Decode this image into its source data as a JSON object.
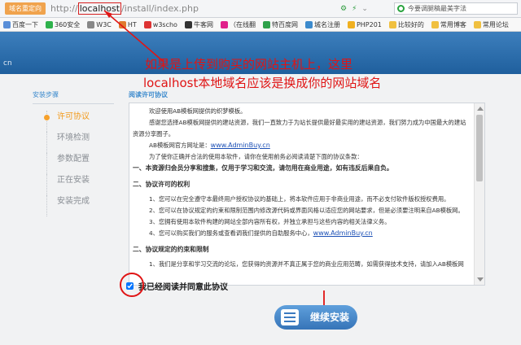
{
  "browser": {
    "redirect_label": "域名重定向",
    "url_prefix": "http://",
    "url_host": "localhost",
    "url_path": "/install/index.php",
    "search_text": "今要调腿稿最美字法"
  },
  "bookmarks": [
    "百度一下",
    "360安全",
    "W3C",
    "HT",
    "w3scho",
    "牛客网",
    "（在线翻",
    "特百度网",
    "城名注册",
    "PHP201",
    "比较好的",
    "常用博客",
    "常用论坛"
  ],
  "banner": {
    "logo_text": "",
    "logo_subtext": "cn"
  },
  "annotation": {
    "line1": "如果是上传到购买的网站主机上，这里",
    "line2": "localhost本地域名应该是换成你的网站域名"
  },
  "steps": {
    "title": "安装步骤",
    "items": [
      "许可协议",
      "环境检测",
      "参数配置",
      "正在安装",
      "安装完成"
    ],
    "active_index": 0
  },
  "main": {
    "title": "阅读许可协议",
    "license": {
      "p1": "欢迎使用AB模板网提供的织梦模板。",
      "p2": "感谢您选择AB模板网提供的建站资源，我们一直致力于为站长提供最好最实用的建站资源，我们努力成为中国最大的建站",
      "p2b": "资源分享圈子。",
      "p3": "AB模板网官方网址是：",
      "p3_link": "www.AdminBuy.cn",
      "p4": "为了使你正确并合法的使用本软件，请你在使用前务必阅读清楚下面的协议条款：",
      "p5": "一、本资源归会员分享和搜集，仅用于学习和交流，请勿用在商业用途，如有违反后果自负。",
      "h2": "二、协议许可的权利",
      "r1": "1、您可以在完全遵守本最终用户授权协议的基础上，将本软件应用于非商业用途，而不必支付软件版权授权费用。",
      "r2": "2、您可以在协议规定的约束和限制范围内修改源代码或界面风格以适应您的网站要求，但是必须要注明来自AB模板网。",
      "r3": "3、您拥有使用本软件构建的网站全部内容所有权，并独立承担与这些内容的相关法律义务。",
      "r4": "4、您可以购买我们的服务或查看调我们提供的自助服务中心，",
      "r4_link": "www.AdminBuy.cn",
      "h3": "二、协议规定的约束和限制",
      "c1": "1、我们是分享和学习交流的论坛，您获得的资源并不真正属于您的商业应用范畴，如需获得技术支持，请加入AB模板网"
    }
  },
  "agree_label": "我已经阅读并同意此协议",
  "continue_label": "继续安装"
}
